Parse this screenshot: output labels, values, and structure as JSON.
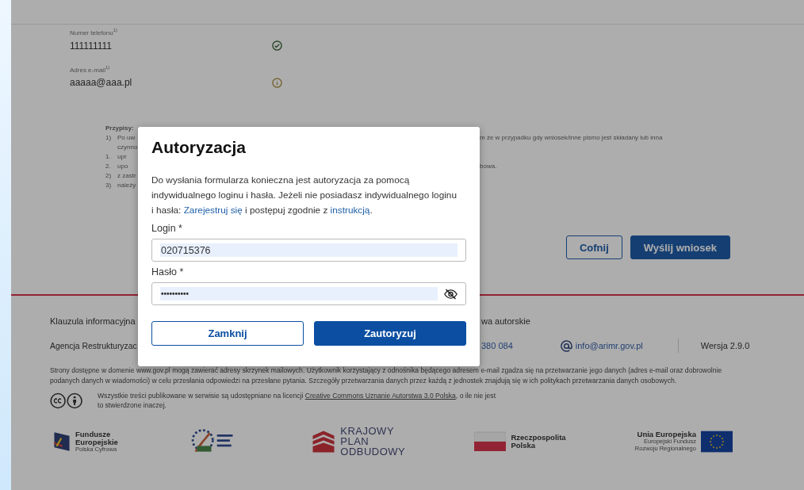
{
  "contact_fields": [
    {
      "label": "Numer telefonu",
      "footnote": "1)",
      "value": "111111111",
      "verified": true
    },
    {
      "label": "Adres e-mail",
      "footnote": "1)",
      "value": "aaaaa@aaa.pl",
      "verified": false
    }
  ],
  "footnotes": {
    "title": "Przypisy:",
    "lines": [
      {
        "mark": "1)",
        "left": "Po uw",
        "right": "m że w przypadku gdy wniosek/inne pismo jest składany lub inna"
      },
      {
        "left": "czynno"
      },
      {
        "mark": "1.",
        "left": "upr"
      },
      {
        "mark": "2.",
        "left": "upo",
        "right": "bowa."
      },
      {
        "mark": "2)",
        "left": "z zastr"
      },
      {
        "mark": "3)",
        "left": "należy"
      }
    ]
  },
  "form_buttons": [
    {
      "label": "Cofnij",
      "kind": "secondary"
    },
    {
      "label": "Wyślij wniosek",
      "kind": "primary"
    }
  ],
  "footer": {
    "info_link": "Klauzula informacyjna",
    "rights_link": "wa autorskie",
    "agency": "Agencja Restrukturyzac",
    "phone": "380 084",
    "email": "info@arimr.gov.pl",
    "version": "Wersja 2.9.0",
    "privacy_note": "Strony dostępne w domenie www.gov.pl mogą zawierać adresy skrzynek mailowych. Użytkownik korzystający z odnośnika będącego adresem e-mail zgadza się na przetwarzanie jego danych (adres e-mail oraz dobrowolnie podanych danych w wiadomości) w celu przesłania odpowiedzi na przesłane pytania. Szczegóły przetwarzania danych przez każdą z jednostek znajdują się w ich politykach przetwarzania danych osobowych.",
    "license": {
      "before": "Wszystkie treści publikowane w serwisie są udostępniane na licencji ",
      "link": "Creative Commons Uznanie Autorstwa 3.0 Polska",
      "after": ", o ile nie jest to stwierdzone inaczej."
    },
    "logos": [
      {
        "kind": "fe",
        "lines": [
          "Fundusze",
          "Europejskie"
        ],
        "sub": [
          "Polska Cyfrowa"
        ]
      },
      {
        "kind": "emblem"
      },
      {
        "kind": "kpo",
        "lines": [
          "KRAJOWY",
          "PLAN",
          "ODBUDOWY"
        ]
      },
      {
        "kind": "flag",
        "lines": [
          "Rzeczpospolita",
          "Polska"
        ]
      },
      {
        "kind": "eu",
        "lines": [
          "Unia Europejska"
        ],
        "sub": [
          "Europejski Fundusz",
          "Rozwoju Regionalnego"
        ]
      }
    ]
  },
  "dialog": {
    "title": "Autoryzacja",
    "message": {
      "before": "Do wysłania formularza konieczna jest autoryzacja za pomocą indywidualnego loginu i hasła. Jeżeli nie posiadasz indywidualnego loginu i hasła: ",
      "link1": "Zarejestruj się",
      "middle": " i postępuj zgodnie z ",
      "link2": "instrukcją",
      "after": "."
    },
    "fields": [
      {
        "label": "Login *",
        "value": "020715376",
        "kind": "text"
      },
      {
        "label": "Hasło *",
        "value": "••••••••••",
        "kind": "password"
      }
    ],
    "buttons": [
      {
        "label": "Zamknij",
        "kind": "secondary"
      },
      {
        "label": "Zautoryzuj",
        "kind": "primary"
      }
    ]
  }
}
